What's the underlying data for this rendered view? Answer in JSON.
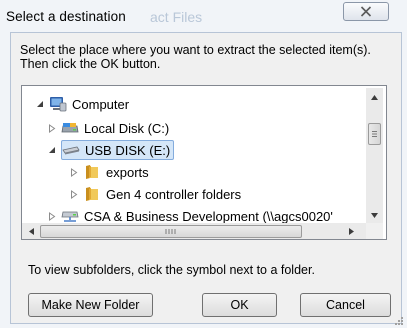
{
  "window": {
    "title": "Select a destination",
    "background_title_fragment": "act Files"
  },
  "instructions": "Select the place where you want to extract the selected item(s).  Then click the OK button.",
  "tree": {
    "items": [
      {
        "label": "Computer",
        "icon": "computer-icon",
        "expanded": true,
        "level": 0
      },
      {
        "label": "Local Disk (C:)",
        "icon": "drive-icon",
        "expanded": false,
        "level": 1
      },
      {
        "label": "USB DISK (E:)",
        "icon": "usb-drive-icon",
        "expanded": true,
        "level": 1,
        "selected": true
      },
      {
        "label": "exports",
        "icon": "folder-icon",
        "expanded": false,
        "level": 2
      },
      {
        "label": "Gen 4 controller folders",
        "icon": "folder-icon",
        "expanded": false,
        "level": 2
      },
      {
        "label": "CSA & Business Development (\\\\agcs0020'",
        "icon": "network-drive-icon",
        "expanded": false,
        "level": 1
      }
    ]
  },
  "hint": "To view subfolders, click the symbol next to a folder.",
  "buttons": {
    "make_new_folder": "Make New Folder",
    "ok": "OK",
    "cancel": "Cancel"
  },
  "colors": {
    "selection": "#d4e6f8",
    "selection_border": "#84acdd",
    "folder": "#e8b84a"
  }
}
